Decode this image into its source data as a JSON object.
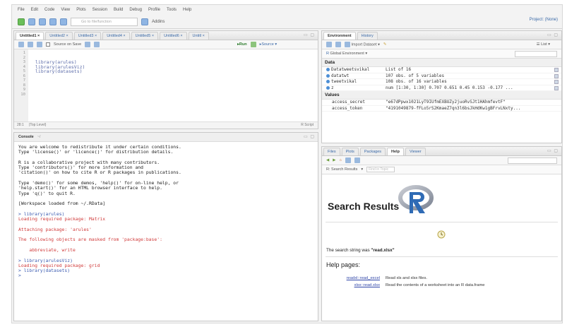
{
  "menu": [
    "File",
    "Edit",
    "Code",
    "View",
    "Plots",
    "Session",
    "Build",
    "Debug",
    "Profile",
    "Tools",
    "Help"
  ],
  "toolbar": {
    "goto_placeholder": "Go to file/function",
    "addins": "Addins",
    "project": "Project: (None)"
  },
  "source": {
    "tabs": [
      "Untitled1",
      "Untitled2",
      "Untitled3",
      "Untitled4",
      "Untitled5",
      "Untitled6",
      "Untitl"
    ],
    "source_on_save": "Source on Save",
    "run": "Run",
    "source": "Source",
    "line_numbers": [
      "1",
      "2",
      "3",
      "4",
      "5",
      "6",
      "7",
      "8",
      "9",
      "10"
    ],
    "code": [
      "",
      "",
      "library(arules)",
      "library(arulesViz)",
      "library(datasets)",
      "",
      "",
      "",
      "",
      ""
    ],
    "status_pos": "28:1",
    "status_level": "(Top Level)",
    "status_type": "R Script"
  },
  "console": {
    "title": "Console",
    "path": "~/",
    "lines": [
      {
        "text": "You are welcome to redistribute it under certain conditions.",
        "c": "t"
      },
      {
        "text": "Type 'license()' or 'licence()' for distribution details.",
        "c": "t"
      },
      {
        "text": "",
        "c": "t"
      },
      {
        "text": "R is a collaborative project with many contributors.",
        "c": "t"
      },
      {
        "text": "Type 'contributors()' for more information and",
        "c": "t"
      },
      {
        "text": "'citation()' on how to cite R or R packages in publications.",
        "c": "t"
      },
      {
        "text": "",
        "c": "t"
      },
      {
        "text": "Type 'demo()' for some demos, 'help()' for on-line help, or",
        "c": "t"
      },
      {
        "text": "'help.start()' for an HTML browser interface to help.",
        "c": "t"
      },
      {
        "text": "Type 'q()' to quit R.",
        "c": "t"
      },
      {
        "text": "",
        "c": "t"
      },
      {
        "text": "[Workspace loaded from ~/.RData]",
        "c": "t"
      },
      {
        "text": "",
        "c": "t"
      },
      {
        "text": "> library(arules)",
        "c": "blue"
      },
      {
        "text": "Loading required package: Matrix",
        "c": "red"
      },
      {
        "text": "",
        "c": "t"
      },
      {
        "text": "Attaching package: 'arules'",
        "c": "red"
      },
      {
        "text": "",
        "c": "t"
      },
      {
        "text": "The following objects are masked from 'package:base':",
        "c": "red"
      },
      {
        "text": "",
        "c": "t"
      },
      {
        "text": "    abbreviate, write",
        "c": "red"
      },
      {
        "text": "",
        "c": "t"
      },
      {
        "text": "> library(arulesViz)",
        "c": "blue"
      },
      {
        "text": "Loading required package: grid",
        "c": "red"
      },
      {
        "text": "> library(datasets)",
        "c": "blue"
      },
      {
        "text": ">",
        "c": "blue"
      }
    ]
  },
  "env": {
    "tabs": [
      "Environment",
      "History"
    ],
    "import": "Import Dataset",
    "list": "List",
    "global": "Global Environment",
    "data_header": "Data",
    "values_header": "Values",
    "data": [
      {
        "name": "Datatweetsvikal",
        "value": "List of 16"
      },
      {
        "name": "datatwt",
        "value": "107 obs. of 5 variables"
      },
      {
        "name": "tweetvikal",
        "value": "108 obs. of 16 variables"
      },
      {
        "name": "z",
        "value": "num [1:30, 1:30] 0.707 0.651 0.45 0.153 -0.177 ..."
      }
    ],
    "values": [
      {
        "name": "access_secret",
        "value": "\"e67dPpwx1021LyT9IUfmEXBUZy2juoRvSJt1HAhmfevtF\""
      },
      {
        "name": "access_token",
        "value": "\"4191049879-fFLo5rS2KmaeZ7qn3l6bsJkHdKw1gBFrvLNxty..."
      }
    ]
  },
  "help": {
    "tabs": [
      "Files",
      "Plots",
      "Packages",
      "Help",
      "Viewer"
    ],
    "results_crumb": "R: Search Results",
    "find_placeholder": "Find in Topic",
    "title": "Search Results",
    "search_string_label": "The search string was ",
    "search_string": "\"read.xlsx\"",
    "help_pages": "Help pages:",
    "results": [
      {
        "link": "readxl::read_excel",
        "desc": "Read xls and xlsx files."
      },
      {
        "link": "xlsx::read.xlsx",
        "desc": "Read the contents of a worksheet into an R data.frame"
      }
    ]
  }
}
